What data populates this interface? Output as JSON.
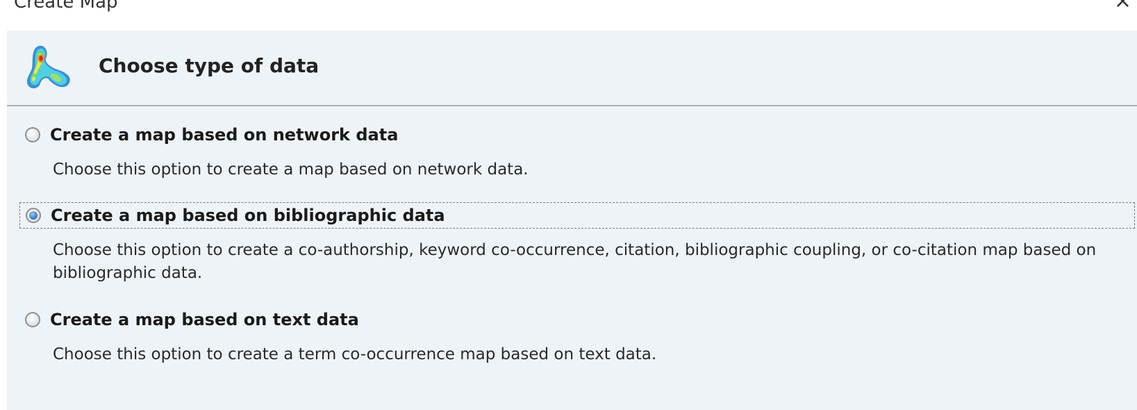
{
  "window": {
    "title": "Create Map",
    "close_label": "×"
  },
  "header": {
    "title": "Choose type of data",
    "logo_icon": "vosviewer-density-logo-icon"
  },
  "options": [
    {
      "label": "Create a map based on network data",
      "description": "Choose this option to create a map based on network data.",
      "selected": false
    },
    {
      "label": "Create a map based on bibliographic data",
      "description": "Choose this option to create a co-authorship, keyword co-occurrence, citation, bibliographic coupling, or co-citation map based on bibliographic data.",
      "selected": true
    },
    {
      "label": "Create a map based on text data",
      "description": "Choose this option to create a term co-occurrence map based on text data.",
      "selected": false
    }
  ],
  "colors": {
    "dialog_background": "#eef3f7",
    "radio_selected": "#3d7fc4",
    "divider": "#a9aeb2"
  }
}
